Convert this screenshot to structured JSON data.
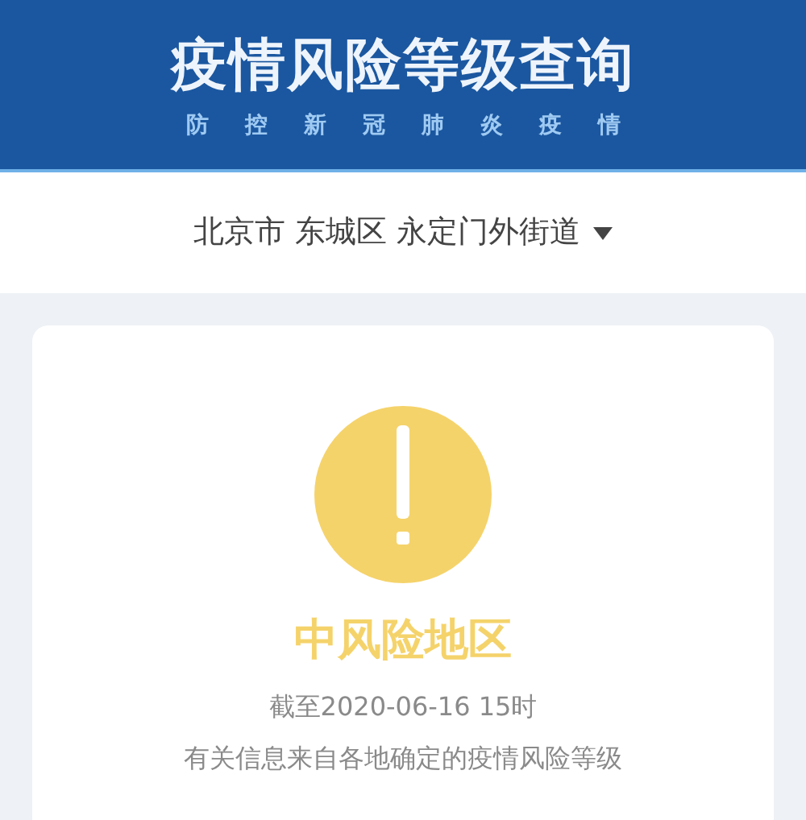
{
  "header": {
    "title": "疫情风险等级查询",
    "subtitle": "防控新冠肺炎疫情"
  },
  "location": {
    "text": "北京市 东城区 永定门外街道",
    "expanded": false
  },
  "result": {
    "color": "#f5d36b",
    "risk_label": "中风险地区",
    "as_of": "截至2020-06-16 15时",
    "note": "有关信息来自各地确定的疫情风险等级"
  }
}
